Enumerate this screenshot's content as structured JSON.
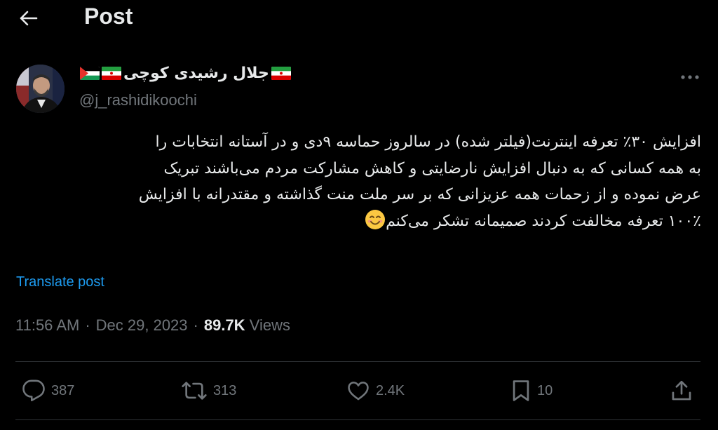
{
  "header": {
    "title": "Post"
  },
  "author": {
    "display_name": "جلال رشیدی کوچی",
    "handle": "@j_rashidikoochi"
  },
  "tweet": {
    "lines": [
      "افزایش ۳۰٪ تعرفه اینترنت(فیلتر شده) در سالروز حماسه ۹دی و در آستانه انتخابات را",
      "به همه کسانی که به دنبال افزایش نارضایتی و کاهش مشارکت مردم می‌باشند تبریک",
      "عرض نموده و از زحمات همه عزیزانی که بر سر ملت منت گذاشته و مقتدرانه با افزایش",
      "۱۰۰٪ تعرفه مخالفت کردند صمیمانه تشکر می‌کنم"
    ],
    "translate_label": "Translate post"
  },
  "meta": {
    "time": "11:56 AM",
    "date": "Dec 29, 2023",
    "views_count": "89.7K",
    "views_label": "Views",
    "separator": "·"
  },
  "actions": {
    "replies": "387",
    "reposts": "313",
    "likes": "2.4K",
    "bookmarks": "10"
  },
  "colors": {
    "background": "#000000",
    "text": "#e7e9ea",
    "muted": "#71767b",
    "link": "#1d9bf0",
    "divider": "#2f3336"
  }
}
